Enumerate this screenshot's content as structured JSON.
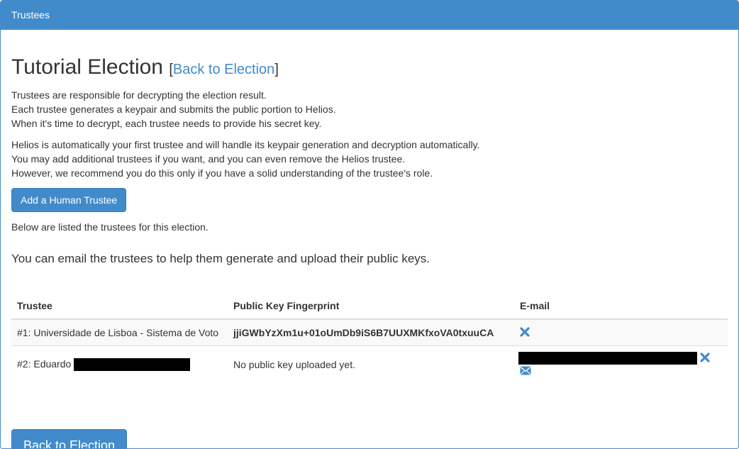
{
  "panel": {
    "title": "Trustees"
  },
  "header": {
    "title": "Tutorial Election",
    "bracket_open": "[",
    "back_link": "Back to Election",
    "bracket_close": "]"
  },
  "intro": {
    "line1": "Trustees are responsible for decrypting the election result.",
    "line2": "Each trustee generates a keypair and submits the public portion to Helios.",
    "line3": "When it's time to decrypt, each trustee needs to provide his secret key.",
    "line4": "Helios is automatically your first trustee and will handle its keypair generation and decryption automatically.",
    "line5": "You may add additional trustees if you want, and you can even remove the Helios trustee.",
    "line6": "However, we recommend you do this only if you have a solid understanding of the trustee's role."
  },
  "add_button": "Add a Human Trustee",
  "below_text": "Below are listed the trustees for this election.",
  "lead_text": "You can email the trustees to help them generate and upload their public keys.",
  "table": {
    "headers": [
      "Trustee",
      "Public Key Fingerprint",
      "E-mail"
    ],
    "rows": [
      {
        "trustee": "#1: Universidade de Lisboa - Sistema de Voto",
        "fingerprint": "jjiGWbYzXm1u+01oUmDb9iS6B7UUXMKfxoVA0txuuCA"
      },
      {
        "trustee": "#2: Eduardo",
        "fingerprint": "No public key uploaded yet."
      }
    ]
  },
  "back_button": "Back to Election",
  "colors": {
    "accent": "#428bca",
    "redaction": "#000000"
  },
  "icons": [
    "remove-icon",
    "envelope-icon"
  ]
}
